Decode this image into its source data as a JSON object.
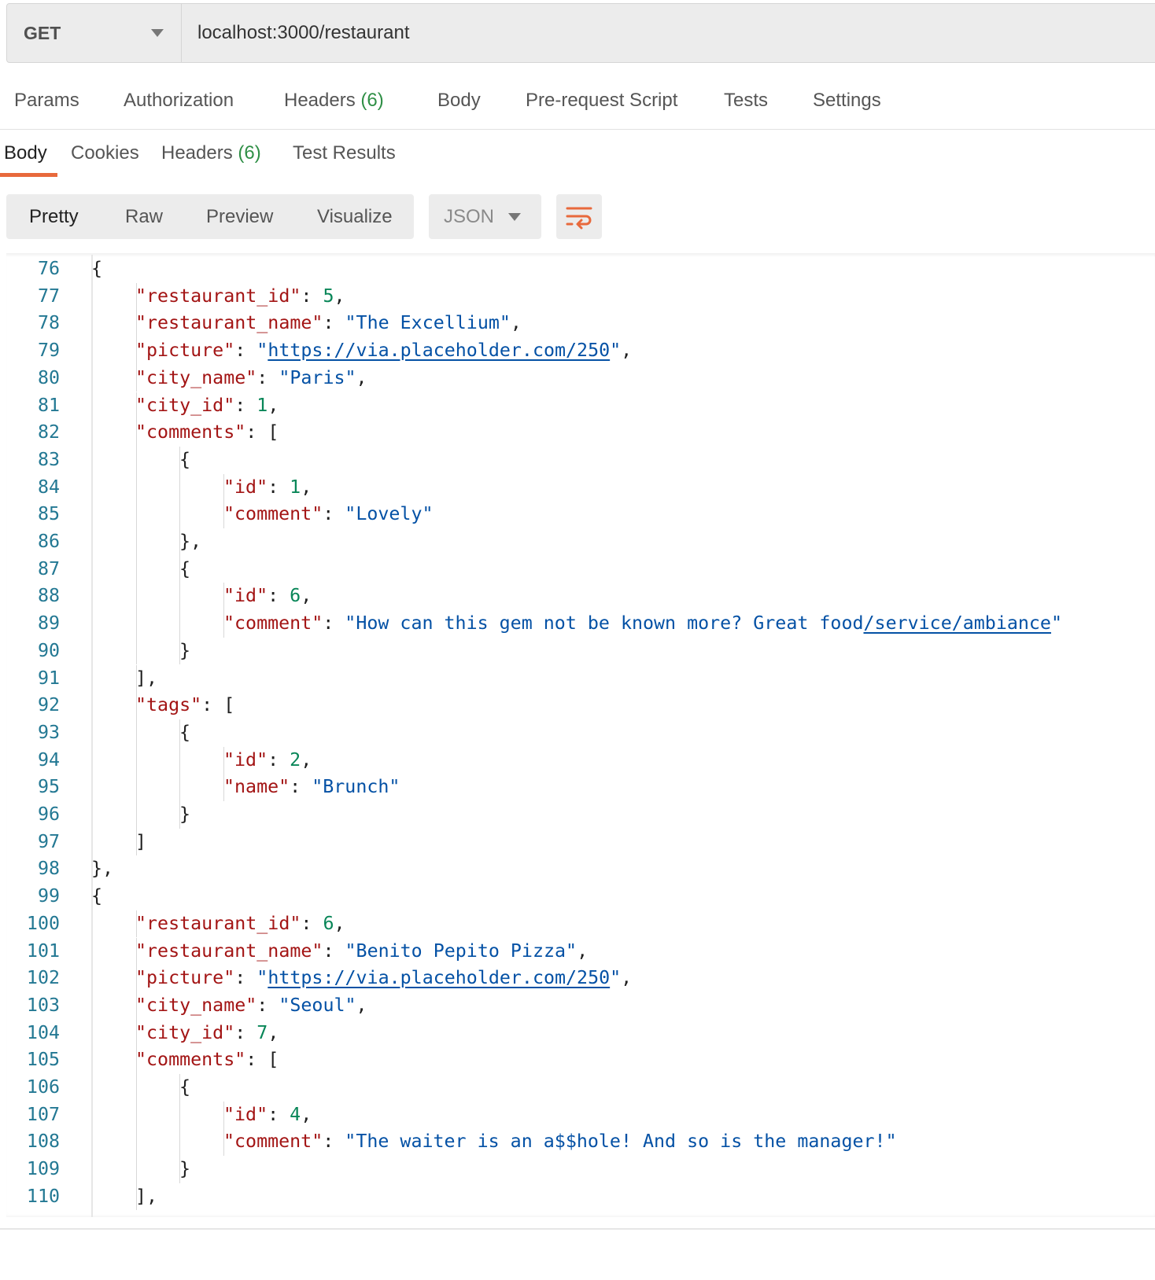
{
  "request": {
    "method": "GET",
    "url": "localhost:3000/restaurant"
  },
  "request_tabs": [
    {
      "label": "Params",
      "count": ""
    },
    {
      "label": "Authorization",
      "count": ""
    },
    {
      "label": "Headers",
      "count": "(6)"
    },
    {
      "label": "Body",
      "count": ""
    },
    {
      "label": "Pre-request Script",
      "count": ""
    },
    {
      "label": "Tests",
      "count": ""
    },
    {
      "label": "Settings",
      "count": ""
    }
  ],
  "response_tabs": [
    {
      "label": "Body",
      "count": "",
      "active": true
    },
    {
      "label": "Cookies",
      "count": "",
      "active": false
    },
    {
      "label": "Headers",
      "count": "(6)",
      "active": false
    },
    {
      "label": "Test Results",
      "count": "",
      "active": false
    }
  ],
  "view_modes": [
    {
      "label": "Pretty",
      "active": true
    },
    {
      "label": "Raw",
      "active": false
    },
    {
      "label": "Preview",
      "active": false
    },
    {
      "label": "Visualize",
      "active": false
    }
  ],
  "format": "JSON",
  "wrap_icon": "wrap-lines-icon",
  "colors": {
    "accent": "#e8693c",
    "key": "#a31515",
    "string": "#0451a5",
    "number": "#098658",
    "line_number": "#237893",
    "count": "#2f8f46"
  },
  "code_lines": [
    {
      "n": "76",
      "indent": 1,
      "tokens": [
        {
          "t": "p",
          "v": "{"
        }
      ]
    },
    {
      "n": "77",
      "indent": 2,
      "tokens": [
        {
          "t": "k",
          "v": "\"restaurant_id\""
        },
        {
          "t": "p",
          "v": ": "
        },
        {
          "t": "n",
          "v": "5"
        },
        {
          "t": "p",
          "v": ","
        }
      ]
    },
    {
      "n": "78",
      "indent": 2,
      "tokens": [
        {
          "t": "k",
          "v": "\"restaurant_name\""
        },
        {
          "t": "p",
          "v": ": "
        },
        {
          "t": "s",
          "v": "\"The Excellium\""
        },
        {
          "t": "p",
          "v": ","
        }
      ]
    },
    {
      "n": "79",
      "indent": 2,
      "tokens": [
        {
          "t": "k",
          "v": "\"picture\""
        },
        {
          "t": "p",
          "v": ": "
        },
        {
          "t": "s",
          "v": "\""
        },
        {
          "t": "l",
          "v": "https://via.placeholder.com/250"
        },
        {
          "t": "s",
          "v": "\""
        },
        {
          "t": "p",
          "v": ","
        }
      ]
    },
    {
      "n": "80",
      "indent": 2,
      "tokens": [
        {
          "t": "k",
          "v": "\"city_name\""
        },
        {
          "t": "p",
          "v": ": "
        },
        {
          "t": "s",
          "v": "\"Paris\""
        },
        {
          "t": "p",
          "v": ","
        }
      ]
    },
    {
      "n": "81",
      "indent": 2,
      "tokens": [
        {
          "t": "k",
          "v": "\"city_id\""
        },
        {
          "t": "p",
          "v": ": "
        },
        {
          "t": "n",
          "v": "1"
        },
        {
          "t": "p",
          "v": ","
        }
      ]
    },
    {
      "n": "82",
      "indent": 2,
      "tokens": [
        {
          "t": "k",
          "v": "\"comments\""
        },
        {
          "t": "p",
          "v": ": ["
        }
      ]
    },
    {
      "n": "83",
      "indent": 3,
      "tokens": [
        {
          "t": "p",
          "v": "{"
        }
      ]
    },
    {
      "n": "84",
      "indent": 4,
      "tokens": [
        {
          "t": "k",
          "v": "\"id\""
        },
        {
          "t": "p",
          "v": ": "
        },
        {
          "t": "n",
          "v": "1"
        },
        {
          "t": "p",
          "v": ","
        }
      ]
    },
    {
      "n": "85",
      "indent": 4,
      "tokens": [
        {
          "t": "k",
          "v": "\"comment\""
        },
        {
          "t": "p",
          "v": ": "
        },
        {
          "t": "s",
          "v": "\"Lovely\""
        }
      ]
    },
    {
      "n": "86",
      "indent": 3,
      "tokens": [
        {
          "t": "p",
          "v": "},"
        }
      ]
    },
    {
      "n": "87",
      "indent": 3,
      "tokens": [
        {
          "t": "p",
          "v": "{"
        }
      ]
    },
    {
      "n": "88",
      "indent": 4,
      "tokens": [
        {
          "t": "k",
          "v": "\"id\""
        },
        {
          "t": "p",
          "v": ": "
        },
        {
          "t": "n",
          "v": "6"
        },
        {
          "t": "p",
          "v": ","
        }
      ]
    },
    {
      "n": "89",
      "indent": 4,
      "tokens": [
        {
          "t": "k",
          "v": "\"comment\""
        },
        {
          "t": "p",
          "v": ": "
        },
        {
          "t": "s",
          "v": "\"How can this gem not be known more? Great food"
        },
        {
          "t": "l",
          "v": "/service/ambiance"
        },
        {
          "t": "s",
          "v": "\""
        }
      ]
    },
    {
      "n": "90",
      "indent": 3,
      "tokens": [
        {
          "t": "p",
          "v": "}"
        }
      ]
    },
    {
      "n": "91",
      "indent": 2,
      "tokens": [
        {
          "t": "p",
          "v": "],"
        }
      ]
    },
    {
      "n": "92",
      "indent": 2,
      "tokens": [
        {
          "t": "k",
          "v": "\"tags\""
        },
        {
          "t": "p",
          "v": ": ["
        }
      ]
    },
    {
      "n": "93",
      "indent": 3,
      "tokens": [
        {
          "t": "p",
          "v": "{"
        }
      ]
    },
    {
      "n": "94",
      "indent": 4,
      "tokens": [
        {
          "t": "k",
          "v": "\"id\""
        },
        {
          "t": "p",
          "v": ": "
        },
        {
          "t": "n",
          "v": "2"
        },
        {
          "t": "p",
          "v": ","
        }
      ]
    },
    {
      "n": "95",
      "indent": 4,
      "tokens": [
        {
          "t": "k",
          "v": "\"name\""
        },
        {
          "t": "p",
          "v": ": "
        },
        {
          "t": "s",
          "v": "\"Brunch\""
        }
      ]
    },
    {
      "n": "96",
      "indent": 3,
      "tokens": [
        {
          "t": "p",
          "v": "}"
        }
      ]
    },
    {
      "n": "97",
      "indent": 2,
      "tokens": [
        {
          "t": "p",
          "v": "]"
        }
      ]
    },
    {
      "n": "98",
      "indent": 1,
      "tokens": [
        {
          "t": "p",
          "v": "},"
        }
      ]
    },
    {
      "n": "99",
      "indent": 1,
      "tokens": [
        {
          "t": "p",
          "v": "{"
        }
      ]
    },
    {
      "n": "100",
      "indent": 2,
      "tokens": [
        {
          "t": "k",
          "v": "\"restaurant_id\""
        },
        {
          "t": "p",
          "v": ": "
        },
        {
          "t": "n",
          "v": "6"
        },
        {
          "t": "p",
          "v": ","
        }
      ]
    },
    {
      "n": "101",
      "indent": 2,
      "tokens": [
        {
          "t": "k",
          "v": "\"restaurant_name\""
        },
        {
          "t": "p",
          "v": ": "
        },
        {
          "t": "s",
          "v": "\"Benito Pepito Pizza\""
        },
        {
          "t": "p",
          "v": ","
        }
      ]
    },
    {
      "n": "102",
      "indent": 2,
      "tokens": [
        {
          "t": "k",
          "v": "\"picture\""
        },
        {
          "t": "p",
          "v": ": "
        },
        {
          "t": "s",
          "v": "\""
        },
        {
          "t": "l",
          "v": "https://via.placeholder.com/250"
        },
        {
          "t": "s",
          "v": "\""
        },
        {
          "t": "p",
          "v": ","
        }
      ]
    },
    {
      "n": "103",
      "indent": 2,
      "tokens": [
        {
          "t": "k",
          "v": "\"city_name\""
        },
        {
          "t": "p",
          "v": ": "
        },
        {
          "t": "s",
          "v": "\"Seoul\""
        },
        {
          "t": "p",
          "v": ","
        }
      ]
    },
    {
      "n": "104",
      "indent": 2,
      "tokens": [
        {
          "t": "k",
          "v": "\"city_id\""
        },
        {
          "t": "p",
          "v": ": "
        },
        {
          "t": "n",
          "v": "7"
        },
        {
          "t": "p",
          "v": ","
        }
      ]
    },
    {
      "n": "105",
      "indent": 2,
      "tokens": [
        {
          "t": "k",
          "v": "\"comments\""
        },
        {
          "t": "p",
          "v": ": ["
        }
      ]
    },
    {
      "n": "106",
      "indent": 3,
      "tokens": [
        {
          "t": "p",
          "v": "{"
        }
      ]
    },
    {
      "n": "107",
      "indent": 4,
      "tokens": [
        {
          "t": "k",
          "v": "\"id\""
        },
        {
          "t": "p",
          "v": ": "
        },
        {
          "t": "n",
          "v": "4"
        },
        {
          "t": "p",
          "v": ","
        }
      ]
    },
    {
      "n": "108",
      "indent": 4,
      "tokens": [
        {
          "t": "k",
          "v": "\"comment\""
        },
        {
          "t": "p",
          "v": ": "
        },
        {
          "t": "s",
          "v": "\"The waiter is an a$$hole! And so is the manager!\""
        }
      ]
    },
    {
      "n": "109",
      "indent": 3,
      "tokens": [
        {
          "t": "p",
          "v": "}"
        }
      ]
    },
    {
      "n": "110",
      "indent": 2,
      "tokens": [
        {
          "t": "p",
          "v": "],"
        }
      ]
    }
  ]
}
